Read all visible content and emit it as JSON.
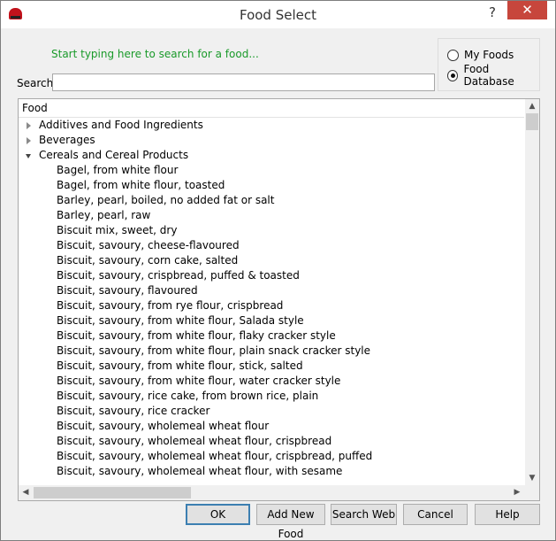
{
  "window": {
    "title": "Food Select",
    "help_glyph": "?",
    "close_glyph": "✕"
  },
  "hint": "Start typing here to search for a food...",
  "source": {
    "options": [
      {
        "label": "My Foods",
        "selected": false
      },
      {
        "label": "Food Database",
        "selected": true
      }
    ]
  },
  "search": {
    "label": "Search",
    "value": ""
  },
  "tree": {
    "column_header": "Food",
    "categories": [
      {
        "label": "Additives and Food Ingredients",
        "expanded": false
      },
      {
        "label": "Beverages",
        "expanded": false
      },
      {
        "label": "Cereals and Cereal Products",
        "expanded": true
      }
    ],
    "foods": [
      "Bagel, from white flour",
      "Bagel, from white flour, toasted",
      "Barley, pearl, boiled, no added fat or salt",
      "Barley, pearl, raw",
      "Biscuit mix, sweet, dry",
      "Biscuit, savoury, cheese-flavoured",
      "Biscuit, savoury, corn cake, salted",
      "Biscuit, savoury, crispbread, puffed & toasted",
      "Biscuit, savoury, flavoured",
      "Biscuit, savoury, from rye flour, crispbread",
      "Biscuit, savoury, from white flour, Salada style",
      "Biscuit, savoury, from white flour, flaky cracker style",
      "Biscuit, savoury, from white flour, plain snack cracker style",
      "Biscuit, savoury, from white flour, stick, salted",
      "Biscuit, savoury, from white flour, water cracker style",
      "Biscuit, savoury, rice cake, from brown rice, plain",
      "Biscuit, savoury, rice cracker",
      "Biscuit, savoury, wholemeal wheat flour",
      "Biscuit, savoury, wholemeal wheat flour, crispbread",
      "Biscuit, savoury, wholemeal wheat flour, crispbread, puffed",
      "Biscuit, savoury, wholemeal wheat flour, with sesame"
    ]
  },
  "buttons": {
    "ok": "OK",
    "add_new_food": "Add New Food",
    "search_web": "Search Web",
    "cancel": "Cancel",
    "help": "Help"
  }
}
